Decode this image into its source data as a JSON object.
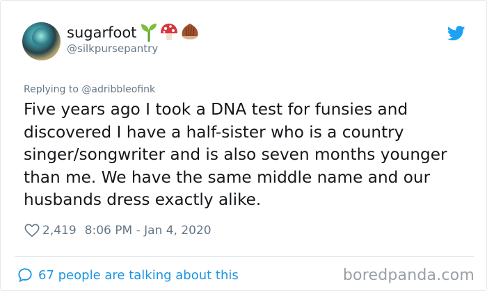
{
  "tweet": {
    "display_name": "sugarfoot",
    "handle": "@silkpursepantry",
    "name_emojis": [
      "seedling-icon",
      "mushroom-icon",
      "chestnut-icon"
    ],
    "replying_to_prefix": "Replying to",
    "replying_to_handle": "@adribbleofink",
    "text_lines": [
      "Five years ago I took a DNA test for funsies and",
      "discovered I have a half-sister who is a country",
      "singer/songwriter and is also seven months younger",
      "than me. We have the same middle name and our",
      "husbands dress exactly alike."
    ],
    "likes": "2,419",
    "timestamp": "8:06 PM - Jan 4, 2020",
    "conversation": "67 people are talking about this"
  },
  "watermark": "boredpanda.com",
  "colors": {
    "accent": "#1b95e0",
    "text": "#14171a",
    "secondary": "#657786",
    "border": "#e1e8ed"
  }
}
